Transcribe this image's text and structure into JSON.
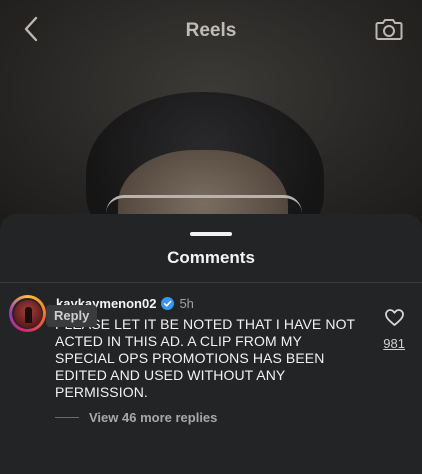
{
  "header": {
    "title": "Reels"
  },
  "comments_sheet": {
    "title": "Comments",
    "comment": {
      "username": "kaykaymenon02",
      "time": "5h",
      "text": "PLEASE LET IT BE NOTED THAT I HAVE NOT ACTED IN THIS AD. A CLIP FROM MY SPECIAL OPS PROMOTIONS HAS BEEN EDITED AND USED WITHOUT ANY PERMISSION.",
      "like_count": "981",
      "reply_label": "Reply",
      "view_replies_label": "View 46 more replies"
    }
  },
  "icons": {
    "back": "chevron-left-icon",
    "camera": "camera-icon",
    "verified": "verified-badge-icon",
    "like": "heart-icon"
  },
  "colors": {
    "sheet_background": "#232425",
    "verified_blue": "#3897f0",
    "reply_button": "#3a3b3d"
  }
}
